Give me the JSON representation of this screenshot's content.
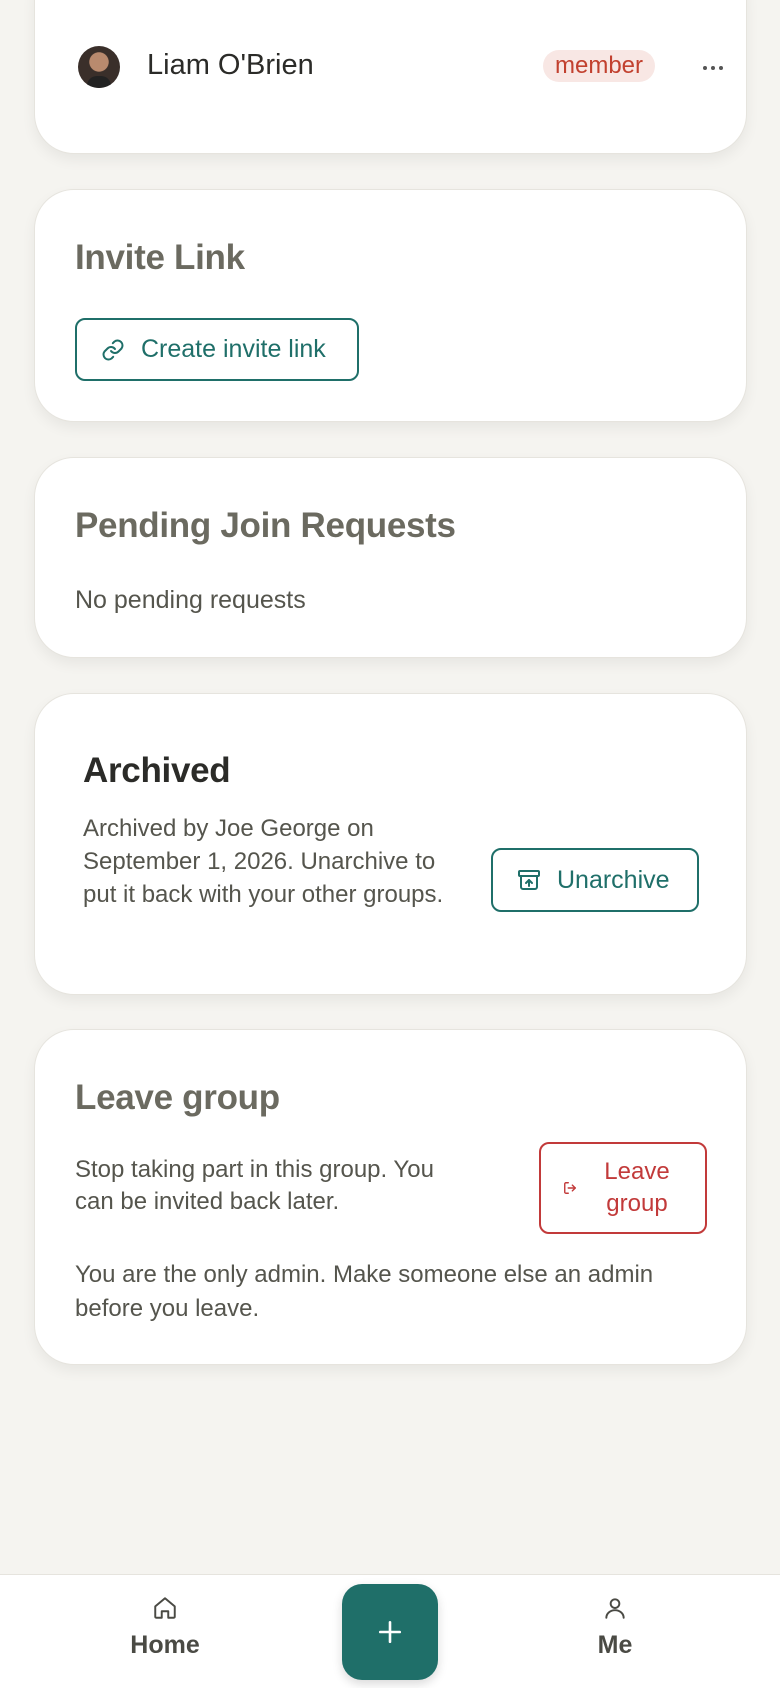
{
  "member": {
    "name": "Liam O'Brien",
    "role": "member",
    "more_label": "···"
  },
  "invite": {
    "title": "Invite Link",
    "button_label": "Create invite link"
  },
  "pending": {
    "title": "Pending Join Requests",
    "empty_text": "No pending requests"
  },
  "archived": {
    "title": "Archived",
    "description": "Archived by Joe George on September 1, 2026. Unarchive to put it back with your other groups.",
    "button_label": "Unarchive"
  },
  "leave": {
    "title": "Leave group",
    "description": "Stop taking part in this group. You can be invited back later.",
    "button_label": "Leave group",
    "note": "You are the only admin. Make someone else an admin before you leave."
  },
  "nav": {
    "home_label": "Home",
    "me_label": "Me",
    "fab_icon": "plus-icon"
  },
  "colors": {
    "accent": "#1f6f69",
    "danger": "#c23a3a",
    "badge_bg": "#f8e7e4",
    "badge_text": "#c2412f",
    "background": "#f5f4f0"
  }
}
